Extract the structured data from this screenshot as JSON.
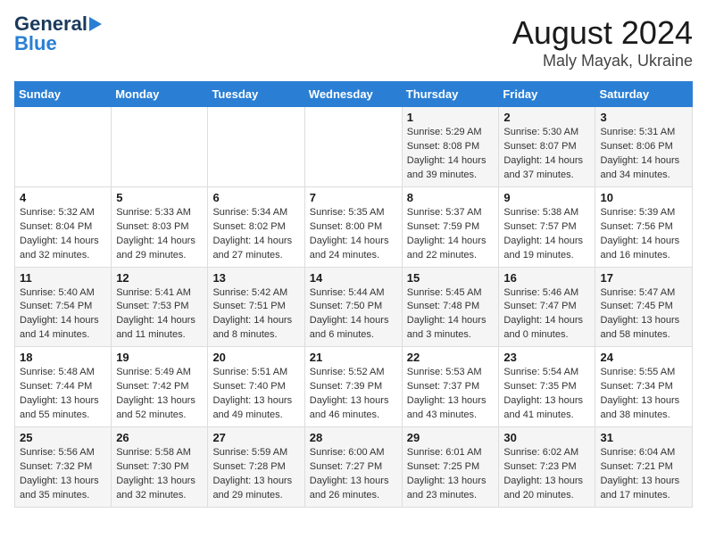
{
  "logo": {
    "line1": "General",
    "line2": "Blue"
  },
  "title": "August 2024",
  "subtitle": "Maly Mayak, Ukraine",
  "weekdays": [
    "Sunday",
    "Monday",
    "Tuesday",
    "Wednesday",
    "Thursday",
    "Friday",
    "Saturday"
  ],
  "weeks": [
    [
      {
        "day": "",
        "info": ""
      },
      {
        "day": "",
        "info": ""
      },
      {
        "day": "",
        "info": ""
      },
      {
        "day": "",
        "info": ""
      },
      {
        "day": "1",
        "info": "Sunrise: 5:29 AM\nSunset: 8:08 PM\nDaylight: 14 hours and 39 minutes."
      },
      {
        "day": "2",
        "info": "Sunrise: 5:30 AM\nSunset: 8:07 PM\nDaylight: 14 hours and 37 minutes."
      },
      {
        "day": "3",
        "info": "Sunrise: 5:31 AM\nSunset: 8:06 PM\nDaylight: 14 hours and 34 minutes."
      }
    ],
    [
      {
        "day": "4",
        "info": "Sunrise: 5:32 AM\nSunset: 8:04 PM\nDaylight: 14 hours and 32 minutes."
      },
      {
        "day": "5",
        "info": "Sunrise: 5:33 AM\nSunset: 8:03 PM\nDaylight: 14 hours and 29 minutes."
      },
      {
        "day": "6",
        "info": "Sunrise: 5:34 AM\nSunset: 8:02 PM\nDaylight: 14 hours and 27 minutes."
      },
      {
        "day": "7",
        "info": "Sunrise: 5:35 AM\nSunset: 8:00 PM\nDaylight: 14 hours and 24 minutes."
      },
      {
        "day": "8",
        "info": "Sunrise: 5:37 AM\nSunset: 7:59 PM\nDaylight: 14 hours and 22 minutes."
      },
      {
        "day": "9",
        "info": "Sunrise: 5:38 AM\nSunset: 7:57 PM\nDaylight: 14 hours and 19 minutes."
      },
      {
        "day": "10",
        "info": "Sunrise: 5:39 AM\nSunset: 7:56 PM\nDaylight: 14 hours and 16 minutes."
      }
    ],
    [
      {
        "day": "11",
        "info": "Sunrise: 5:40 AM\nSunset: 7:54 PM\nDaylight: 14 hours and 14 minutes."
      },
      {
        "day": "12",
        "info": "Sunrise: 5:41 AM\nSunset: 7:53 PM\nDaylight: 14 hours and 11 minutes."
      },
      {
        "day": "13",
        "info": "Sunrise: 5:42 AM\nSunset: 7:51 PM\nDaylight: 14 hours and 8 minutes."
      },
      {
        "day": "14",
        "info": "Sunrise: 5:44 AM\nSunset: 7:50 PM\nDaylight: 14 hours and 6 minutes."
      },
      {
        "day": "15",
        "info": "Sunrise: 5:45 AM\nSunset: 7:48 PM\nDaylight: 14 hours and 3 minutes."
      },
      {
        "day": "16",
        "info": "Sunrise: 5:46 AM\nSunset: 7:47 PM\nDaylight: 14 hours and 0 minutes."
      },
      {
        "day": "17",
        "info": "Sunrise: 5:47 AM\nSunset: 7:45 PM\nDaylight: 13 hours and 58 minutes."
      }
    ],
    [
      {
        "day": "18",
        "info": "Sunrise: 5:48 AM\nSunset: 7:44 PM\nDaylight: 13 hours and 55 minutes."
      },
      {
        "day": "19",
        "info": "Sunrise: 5:49 AM\nSunset: 7:42 PM\nDaylight: 13 hours and 52 minutes."
      },
      {
        "day": "20",
        "info": "Sunrise: 5:51 AM\nSunset: 7:40 PM\nDaylight: 13 hours and 49 minutes."
      },
      {
        "day": "21",
        "info": "Sunrise: 5:52 AM\nSunset: 7:39 PM\nDaylight: 13 hours and 46 minutes."
      },
      {
        "day": "22",
        "info": "Sunrise: 5:53 AM\nSunset: 7:37 PM\nDaylight: 13 hours and 43 minutes."
      },
      {
        "day": "23",
        "info": "Sunrise: 5:54 AM\nSunset: 7:35 PM\nDaylight: 13 hours and 41 minutes."
      },
      {
        "day": "24",
        "info": "Sunrise: 5:55 AM\nSunset: 7:34 PM\nDaylight: 13 hours and 38 minutes."
      }
    ],
    [
      {
        "day": "25",
        "info": "Sunrise: 5:56 AM\nSunset: 7:32 PM\nDaylight: 13 hours and 35 minutes."
      },
      {
        "day": "26",
        "info": "Sunrise: 5:58 AM\nSunset: 7:30 PM\nDaylight: 13 hours and 32 minutes."
      },
      {
        "day": "27",
        "info": "Sunrise: 5:59 AM\nSunset: 7:28 PM\nDaylight: 13 hours and 29 minutes."
      },
      {
        "day": "28",
        "info": "Sunrise: 6:00 AM\nSunset: 7:27 PM\nDaylight: 13 hours and 26 minutes."
      },
      {
        "day": "29",
        "info": "Sunrise: 6:01 AM\nSunset: 7:25 PM\nDaylight: 13 hours and 23 minutes."
      },
      {
        "day": "30",
        "info": "Sunrise: 6:02 AM\nSunset: 7:23 PM\nDaylight: 13 hours and 20 minutes."
      },
      {
        "day": "31",
        "info": "Sunrise: 6:04 AM\nSunset: 7:21 PM\nDaylight: 13 hours and 17 minutes."
      }
    ]
  ]
}
